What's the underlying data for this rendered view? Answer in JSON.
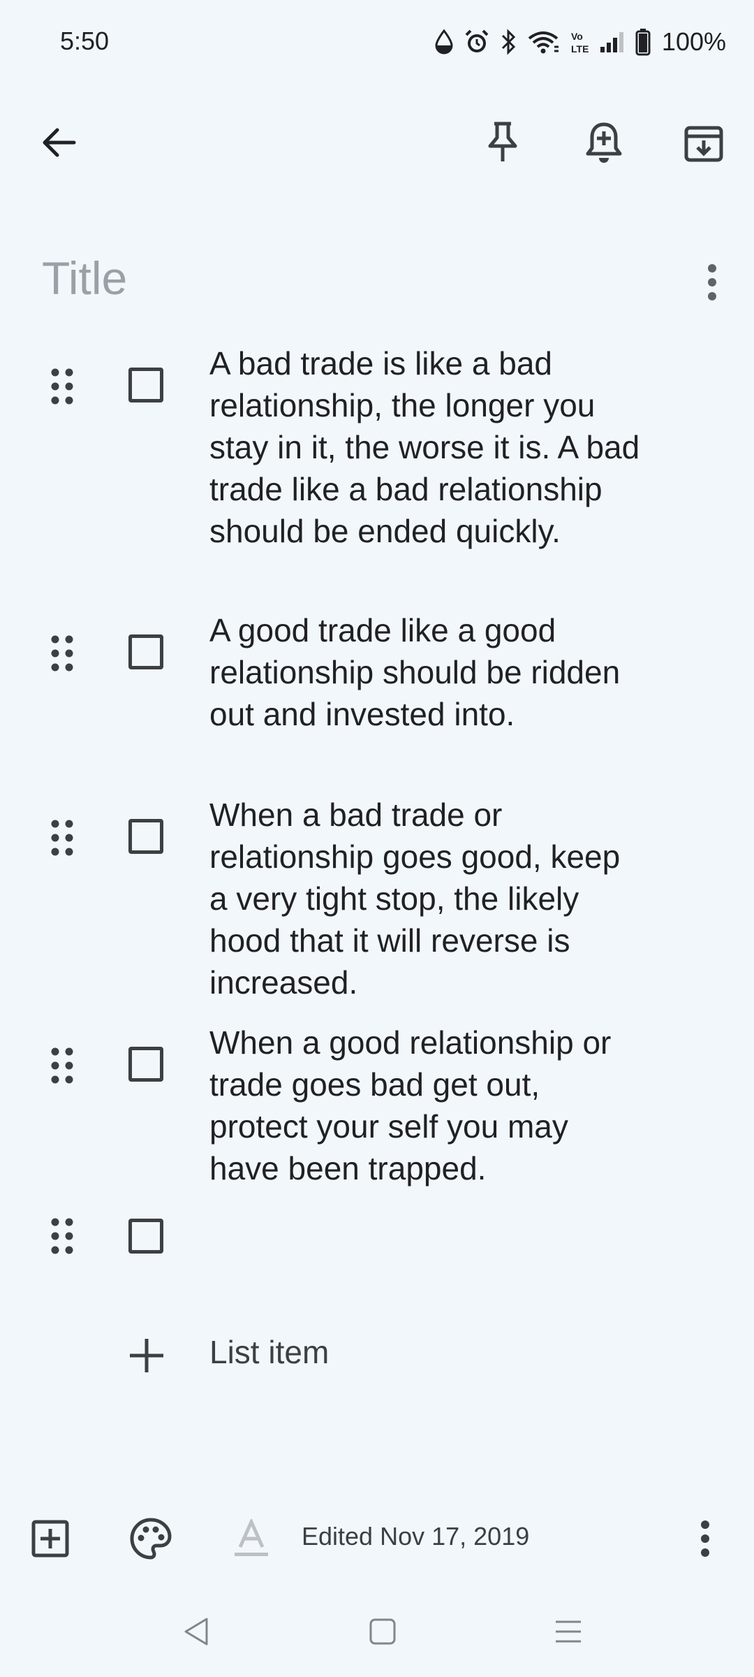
{
  "status": {
    "time": "5:50",
    "battery": "100%",
    "icons": [
      "water-drop-icon",
      "alarm-icon",
      "bluetooth-icon",
      "wifi-icon",
      "volte-icon",
      "signal-icon",
      "battery-icon"
    ]
  },
  "toolbar": {
    "back_icon": "arrow-back-icon",
    "pin_icon": "pin-icon",
    "reminder_icon": "add-alert-icon",
    "archive_icon": "archive-icon"
  },
  "note": {
    "title_placeholder": "Title",
    "items": [
      {
        "text": "A bad trade is like a bad relationship, the longer you stay in it, the worse it is. A bad trade like a bad relationship should be ended quickly.",
        "checked": false
      },
      {
        "text": "A good trade like a good relationship should be ridden out and invested into.",
        "checked": false
      },
      {
        "text": "When a bad trade or relationship goes good, keep a very tight stop, the likely hood that it will reverse is increased.",
        "checked": false
      },
      {
        "text": "When a good relationship or trade goes bad get out, protect your self you may have been trapped.",
        "checked": false
      },
      {
        "text": "",
        "checked": false
      }
    ],
    "add_item_label": "List item"
  },
  "bottom": {
    "edited": "Edited Nov 17, 2019"
  },
  "colors": {
    "background": "#f2f7fc",
    "icon": "#3c4043",
    "placeholder": "#9aa0a6"
  }
}
